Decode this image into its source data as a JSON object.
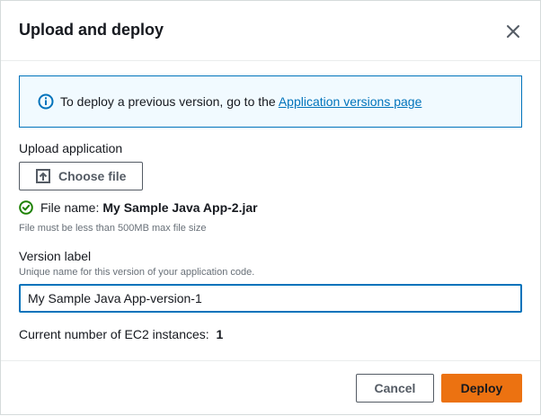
{
  "dialog": {
    "title": "Upload and deploy"
  },
  "info": {
    "text": "To deploy a previous version, go to the ",
    "link": "Application versions page"
  },
  "upload": {
    "label": "Upload application",
    "button_label": "Choose file",
    "file_prefix": "File name:",
    "file_name": "My Sample Java App-2.jar",
    "hint": "File must be less than 500MB max file size"
  },
  "version": {
    "label": "Version label",
    "description": "Unique name for this version of your application code.",
    "value": "My Sample Java App-version-1"
  },
  "instances": {
    "label": "Current number of EC2 instances:",
    "count": "1"
  },
  "footer": {
    "cancel_label": "Cancel",
    "deploy_label": "Deploy"
  },
  "colors": {
    "accent": "#0073bb",
    "primary_button": "#ec7211",
    "success": "#1d8102"
  },
  "icons": {
    "close": "close-icon",
    "info": "info-icon",
    "upload": "upload-icon",
    "success": "check-circle-icon"
  }
}
